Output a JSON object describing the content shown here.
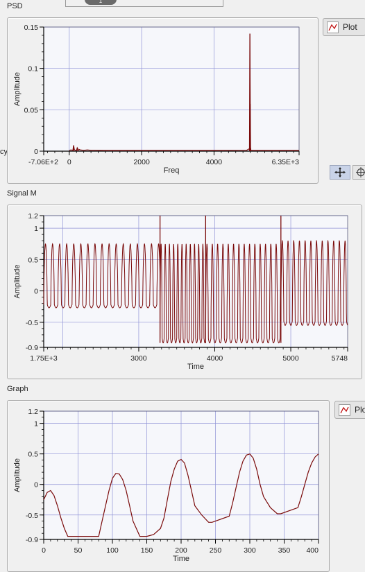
{
  "tab": {
    "index": "1"
  },
  "cut_label": "cy",
  "charts": [
    {
      "caption": "PSD",
      "legend_label": "Plot",
      "ylabel": "Amplitude",
      "xlabel": "Freq",
      "xtick_labels": [
        "-7.06E+2",
        "0",
        "2000",
        "4000",
        "6.35E+3"
      ],
      "ytick_labels": [
        "0.15",
        "0.1",
        "0.05",
        "0"
      ]
    },
    {
      "caption": "Signal M",
      "ylabel": "Amplitude",
      "xlabel": "Time",
      "xtick_labels": [
        "1.75E+3",
        "3000",
        "4000",
        "5000",
        "5748"
      ],
      "ytick_labels": [
        "1.2",
        "1",
        "0.5",
        "0",
        "-0.5",
        "-0.9"
      ]
    },
    {
      "caption": "Graph",
      "legend_label": "Plot",
      "ylabel": "Amplitude",
      "xlabel": "Time",
      "xtick_labels": [
        "0",
        "50",
        "100",
        "150",
        "200",
        "250",
        "300",
        "350",
        "400"
      ],
      "ytick_labels": [
        "1.2",
        "1",
        "0.5",
        "0",
        "-0.5",
        "-0.9"
      ]
    }
  ],
  "colors": {
    "plot_line": "#7a0a0a",
    "plot_bg": "#f6f7fb",
    "grid": "#8f92d6",
    "frame": "#000000"
  },
  "icons": {
    "legend": "line-plot-icon",
    "cursor_tool": "crosshair-icon",
    "pan_tool": "pan-icon"
  },
  "chart_data": [
    {
      "type": "line",
      "title": "PSD",
      "xlabel": "Freq",
      "ylabel": "Amplitude",
      "xlim": [
        -706,
        6350
      ],
      "ylim": [
        0,
        0.15
      ],
      "grid": true,
      "legend": "top-right",
      "series": [
        {
          "name": "Plot",
          "x": [
            0,
            50,
            100,
            120,
            140,
            160,
            200,
            220,
            260,
            280,
            300,
            400,
            500,
            600,
            700,
            1000,
            2000,
            3000,
            4000,
            4900,
            4980,
            4990,
            5000,
            5010,
            5020,
            5100,
            6000,
            6350
          ],
          "y": [
            0.001,
            0.0015,
            0.001,
            0.007,
            0.002,
            0.001,
            0.001,
            0.004,
            0.001,
            0.002,
            0.0015,
            0.001,
            0.0015,
            0.001,
            0.001,
            0.0008,
            0.0008,
            0.0008,
            0.0008,
            0.001,
            0.003,
            0.142,
            0.057,
            0.004,
            0.001,
            0.0008,
            0.0008,
            0.0008
          ]
        }
      ]
    },
    {
      "type": "line",
      "title": "Signal M",
      "xlabel": "Time",
      "ylabel": "Amplitude",
      "xlim": [
        1750,
        5748
      ],
      "ylim": [
        -0.9,
        1.2
      ],
      "grid": true,
      "series": [
        {
          "name": "",
          "segments": [
            {
              "x0": 1750,
              "x1": 3280,
              "period": 93,
              "hi": 0.75,
              "lo": -0.27
            },
            {
              "x0": 3280,
              "x1": 3880,
              "period": 55,
              "hi": 0.75,
              "lo": -0.83
            },
            {
              "x0": 3880,
              "x1": 4870,
              "period": 70,
              "hi": 0.75,
              "lo": -0.83
            },
            {
              "x0": 4870,
              "x1": 5748,
              "period": 75,
              "hi": 0.8,
              "lo": -0.55
            }
          ],
          "spikes": [
            {
              "x": 3280,
              "y": 1.2
            },
            {
              "x": 3880,
              "y": 1.2
            },
            {
              "x": 4870,
              "y": 1.2
            }
          ]
        }
      ]
    },
    {
      "type": "line",
      "title": "Graph",
      "xlabel": "Time",
      "ylabel": "Amplitude",
      "xlim": [
        0,
        400
      ],
      "ylim": [
        -0.9,
        1.2
      ],
      "grid": true,
      "legend": "top-right",
      "series": [
        {
          "name": "Plot",
          "x": [
            0,
            5,
            10,
            15,
            20,
            25,
            30,
            35,
            40,
            60,
            70,
            80,
            85,
            90,
            95,
            100,
            105,
            110,
            115,
            120,
            125,
            130,
            140,
            145,
            150,
            160,
            170,
            175,
            180,
            185,
            190,
            195,
            200,
            205,
            210,
            215,
            220,
            230,
            240,
            245,
            270,
            275,
            280,
            285,
            290,
            295,
            300,
            305,
            310,
            315,
            320,
            330,
            340,
            345,
            370,
            375,
            380,
            385,
            390,
            395,
            400
          ],
          "y": [
            -0.25,
            -0.13,
            -0.1,
            -0.18,
            -0.35,
            -0.55,
            -0.72,
            -0.85,
            -0.85,
            -0.85,
            -0.85,
            -0.85,
            -0.6,
            -0.35,
            -0.1,
            0.1,
            0.18,
            0.17,
            0.08,
            -0.1,
            -0.35,
            -0.6,
            -0.85,
            -0.85,
            -0.85,
            -0.82,
            -0.72,
            -0.55,
            -0.25,
            0.05,
            0.25,
            0.38,
            0.41,
            0.35,
            0.15,
            -0.1,
            -0.35,
            -0.5,
            -0.62,
            -0.62,
            -0.52,
            -0.3,
            -0.05,
            0.2,
            0.38,
            0.48,
            0.5,
            0.43,
            0.25,
            0.0,
            -0.2,
            -0.38,
            -0.48,
            -0.48,
            -0.38,
            -0.2,
            0.0,
            0.2,
            0.35,
            0.45,
            0.5
          ]
        }
      ]
    }
  ]
}
